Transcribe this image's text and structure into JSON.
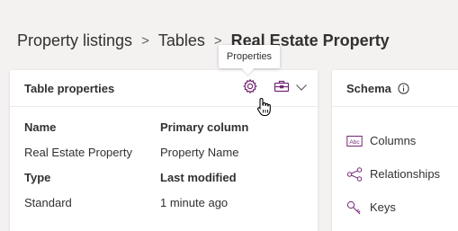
{
  "breadcrumb": {
    "items": [
      "Property listings",
      "Tables"
    ],
    "current": "Real Estate Property",
    "separator": ">"
  },
  "tooltip": {
    "text": "Properties"
  },
  "table_properties": {
    "title": "Table properties",
    "icons": [
      "gear-icon",
      "toolbox-icon",
      "chevron-down-icon"
    ],
    "fields": {
      "name_label": "Name",
      "name_value": "Real Estate Property",
      "primary_column_label": "Primary column",
      "primary_column_value": "Property Name",
      "type_label": "Type",
      "type_value": "Standard",
      "last_modified_label": "Last modified",
      "last_modified_value": "1 minute ago"
    }
  },
  "schema": {
    "title": "Schema",
    "items": [
      {
        "label": "Columns",
        "icon": "columns-icon"
      },
      {
        "label": "Relationships",
        "icon": "relationships-icon"
      },
      {
        "label": "Keys",
        "icon": "keys-icon"
      }
    ]
  },
  "colors": {
    "accent": "#742774",
    "background": "#f3f2f1",
    "text": "#323130"
  }
}
